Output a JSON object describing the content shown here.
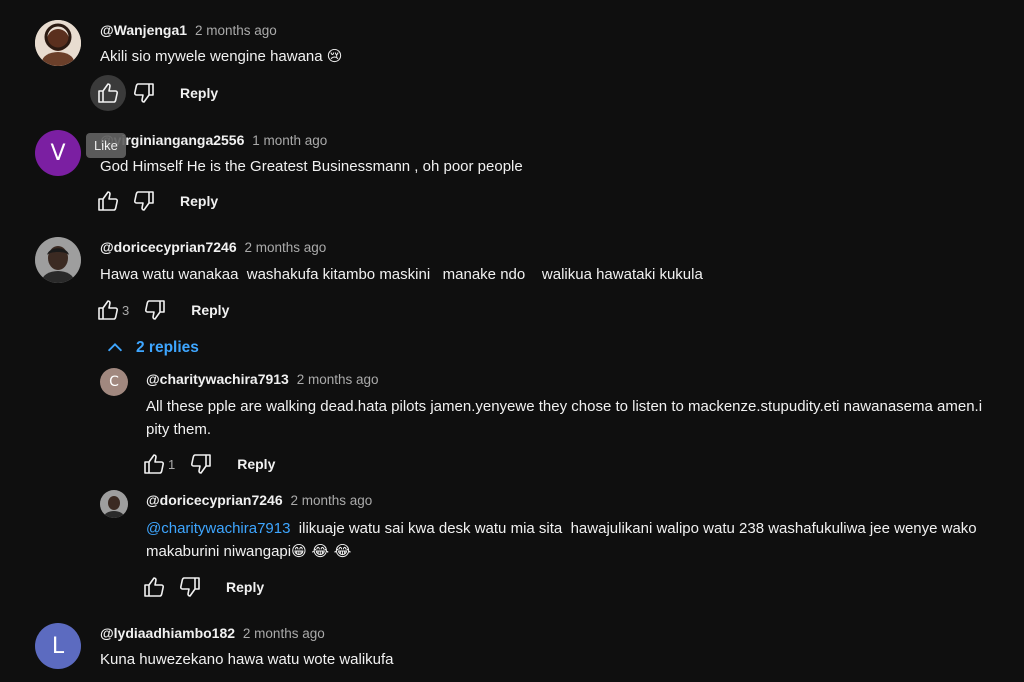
{
  "comments": [
    {
      "author": "@Wanjenga1",
      "time": "2 months ago",
      "text": "Akili sio mywele wengine hawana",
      "emoji": "😢",
      "like_count": "",
      "reply_label": "Reply",
      "avatar_color": "#c9b8a8"
    },
    {
      "author": "@virginianganga2556",
      "time": "1 month ago",
      "text": "God Himself He is the Greatest Businessmann , oh poor people",
      "like_count": "",
      "reply_label": "Reply",
      "avatar_letter": "V",
      "avatar_color": "#7b1fa2"
    },
    {
      "author": "@doricecyprian7246",
      "time": "2 months ago",
      "text": "Hawa watu wanakaa  washakufa kitambo maskini   manake ndo    walikua hawataki kukula",
      "like_count": "3",
      "reply_label": "Reply",
      "avatar_color": "#3a3a3a",
      "replies_toggle": "2 replies",
      "replies": [
        {
          "author": "@charitywachira7913",
          "time": "2 months ago",
          "text": "All these pple are walking dead.hata pilots jamen.yenyewe they chose to listen to mackenze.stupudity.eti nawanasema amen.i pity them.",
          "like_count": "1",
          "reply_label": "Reply",
          "avatar_letter": "C",
          "avatar_color": "#a1887f"
        },
        {
          "author": "@doricecyprian7246",
          "time": "2 months ago",
          "mention": "@charitywachira7913",
          "text": "  ilikuaje watu sai kwa desk watu mia sita  hawajulikani walipo watu 238 washafukuliwa jee wenye wako makaburini niwangapi",
          "emoji": "😁 😂 😂",
          "like_count": "",
          "reply_label": "Reply",
          "avatar_color": "#3a3a3a"
        }
      ]
    },
    {
      "author": "@lydiaadhiambo182",
      "time": "2 months ago",
      "text": "Kuna huwezekano hawa watu wote walikufa",
      "avatar_letter": "L",
      "avatar_color": "#5c6bc0"
    }
  ],
  "tooltip": {
    "label": "Like"
  },
  "icons": {
    "like": "thumbs-up-icon",
    "dislike": "thumbs-down-icon",
    "collapse": "chevron-up-icon"
  }
}
